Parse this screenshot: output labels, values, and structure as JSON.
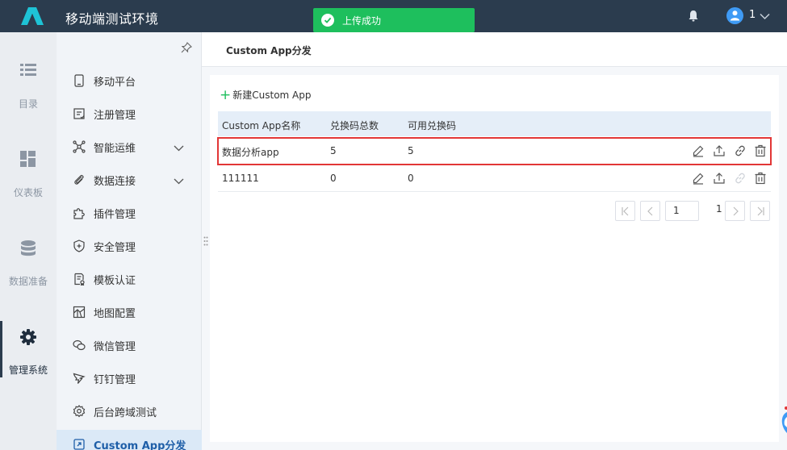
{
  "header": {
    "title": "移动端测试环境",
    "toast": "上传成功",
    "user_name": "1"
  },
  "rail": {
    "items": [
      {
        "label": "目录",
        "icon": "list-icon"
      },
      {
        "label": "仪表板",
        "icon": "dashboard-icon"
      },
      {
        "label": "数据准备",
        "icon": "database-icon"
      },
      {
        "label": "管理系统",
        "icon": "gear-icon",
        "active": true
      }
    ]
  },
  "menu": {
    "items": [
      {
        "label": "移动平台",
        "icon": "mobile-icon"
      },
      {
        "label": "注册管理",
        "icon": "register-icon"
      },
      {
        "label": "智能运维",
        "icon": "network-icon",
        "expandable": true
      },
      {
        "label": "数据连接",
        "icon": "attachment-icon",
        "expandable": true
      },
      {
        "label": "插件管理",
        "icon": "puzzle-icon"
      },
      {
        "label": "安全管理",
        "icon": "shield-icon"
      },
      {
        "label": "模板认证",
        "icon": "template-icon"
      },
      {
        "label": "地图配置",
        "icon": "map-icon"
      },
      {
        "label": "微信管理",
        "icon": "wechat-icon"
      },
      {
        "label": "钉钉管理",
        "icon": "dingtalk-icon"
      },
      {
        "label": "后台跨域测试",
        "icon": "settings-icon"
      },
      {
        "label": "Custom App分发",
        "icon": "app-icon",
        "active": true
      }
    ]
  },
  "main": {
    "page_title": "Custom App分发",
    "new_button": "新建Custom App",
    "table": {
      "columns": [
        "Custom App名称",
        "兑换码总数",
        "可用兑换码"
      ],
      "rows": [
        {
          "name": "数据分析app",
          "total": "5",
          "available": "5",
          "highlighted": true,
          "link_enabled": true
        },
        {
          "name": "111111",
          "total": "0",
          "available": "0",
          "highlighted": false,
          "link_enabled": false
        }
      ]
    },
    "pagination": {
      "current_page": "1",
      "total_pages": "1"
    }
  },
  "colors": {
    "topbar": "#2b3c4e",
    "toast": "#1ebf5d",
    "accent": "#3f9bf5",
    "highlight": "#e23636"
  }
}
